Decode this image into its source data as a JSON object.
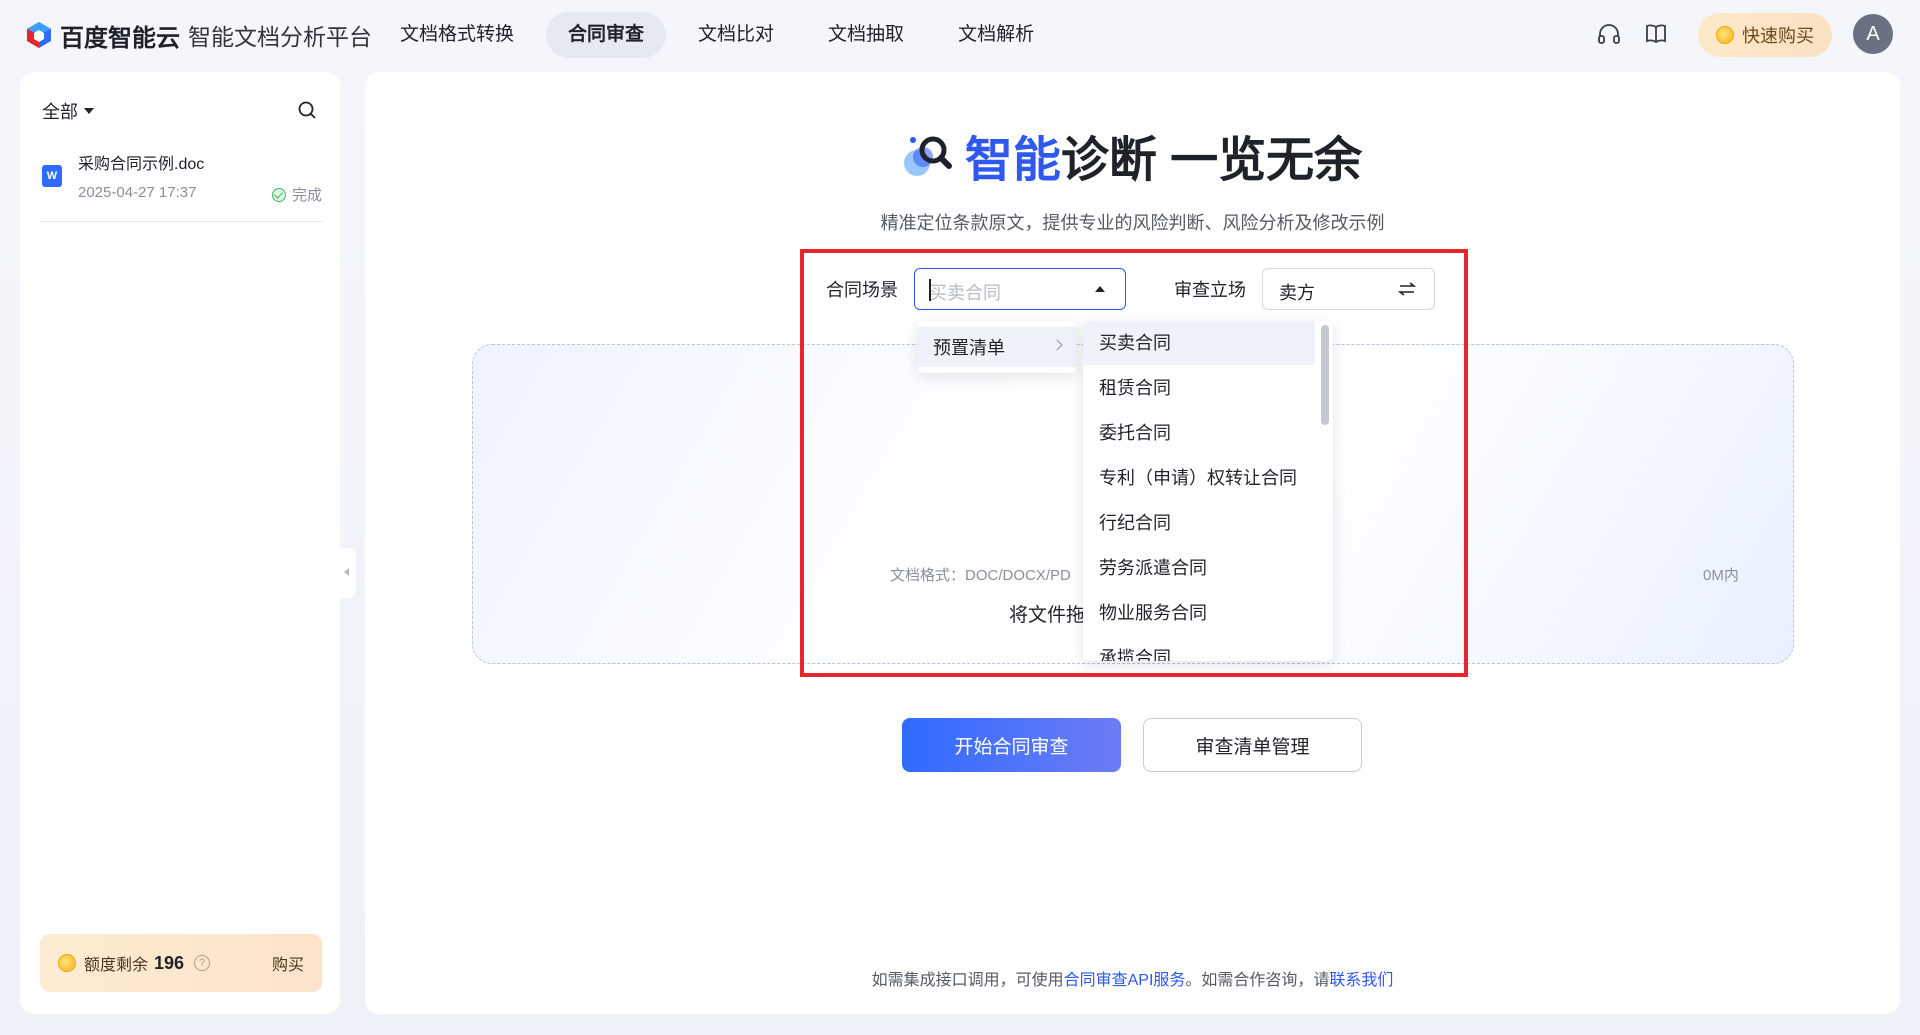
{
  "topbar": {
    "brand": "百度智能云",
    "product": "智能文档分析平台",
    "nav": [
      "文档格式转换",
      "合同审查",
      "文档比对",
      "文档抽取",
      "文档解析"
    ],
    "active_nav": "合同审查",
    "buy_label": "快速购买",
    "avatar_letter": "A"
  },
  "sidebar": {
    "filter_label": "全部",
    "documents": [
      {
        "name": "采购合同示例.doc",
        "time": "2025-04-27 17:37",
        "status": "完成",
        "type_icon": "W"
      }
    ],
    "quota_label": "额度剩余",
    "quota_value": "196",
    "quota_help": "?",
    "quota_buy": "购买"
  },
  "main": {
    "title_accent": "智能",
    "title_rest": "诊断 一览无余",
    "subtitle": "精准定位条款原文，提供专业的风险判断、风险分析及修改示例",
    "scene_label": "合同场景",
    "scene_placeholder": "买卖合同",
    "stance_label": "审查立场",
    "stance_value": "卖方",
    "cascader_group": "预置清单",
    "cascader_options": [
      "买卖合同",
      "租赁合同",
      "委托合同",
      "专利（申请）权转让合同",
      "行纪合同",
      "劳务派遣合同",
      "物业服务合同",
      "承揽合同"
    ],
    "selected_option": "买卖合同",
    "upload_text": "将文件拖",
    "upload_format": "文档格式：DOC/DOCX/PD",
    "upload_size": "0M内",
    "start_button": "开始合同审查",
    "manage_button": "审查清单管理",
    "footer_prefix": "如需集成接口调用，可使用",
    "footer_link1": "合同审查API服务",
    "footer_middle": "。如需合作咨询，请",
    "footer_link2": "联系我们"
  },
  "colors": {
    "accent": "#2f58f0",
    "highlight_border": "#e8242c",
    "success": "#39b85c"
  }
}
